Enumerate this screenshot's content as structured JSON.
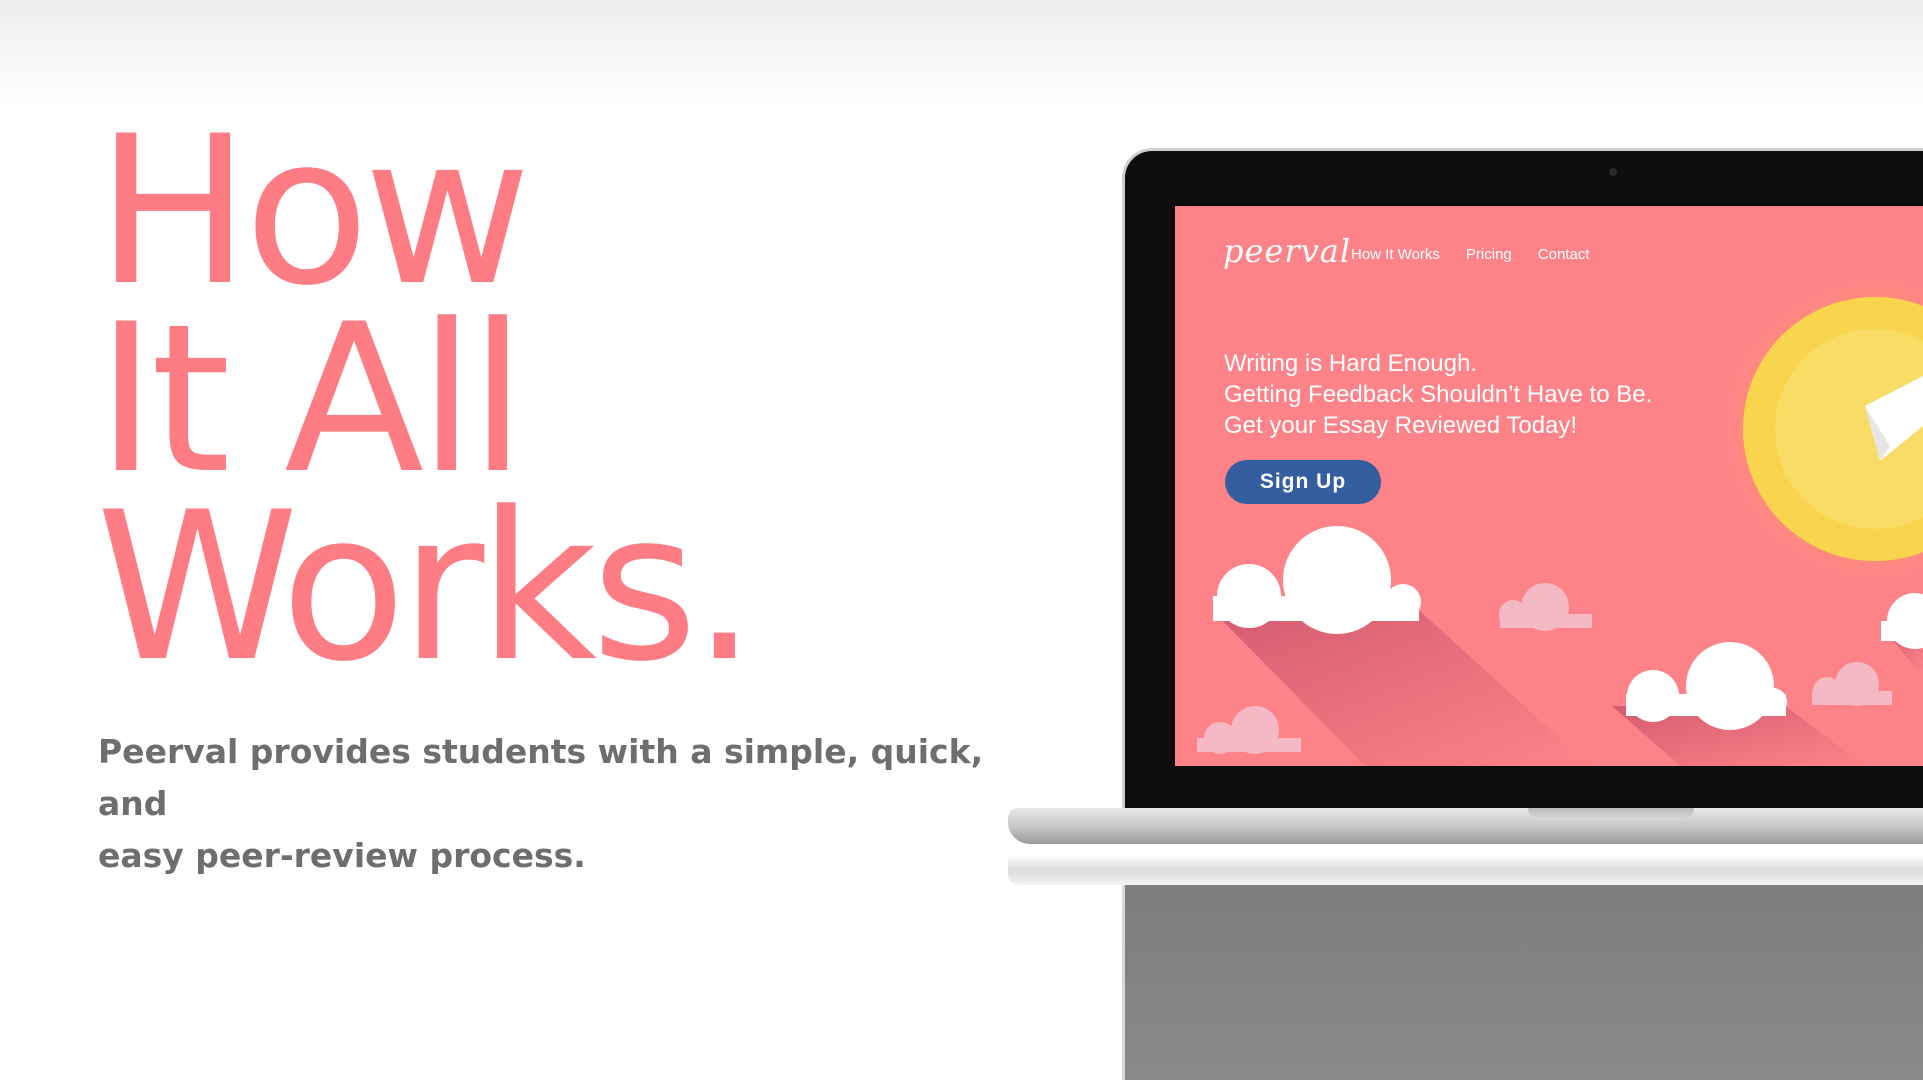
{
  "headline": {
    "line1": "How",
    "line2": "It All",
    "line3": "Works."
  },
  "tagline": {
    "line1": "Peerval provides students with a simple, quick, and",
    "line2": "easy peer-review process."
  },
  "site": {
    "logo": "peerval",
    "nav": [
      "How It Works",
      "Pricing",
      "Contact"
    ],
    "hero_lines": [
      "Writing is Hard Enough.",
      "Getting Feedback Shouldn’t Have to Be.",
      "Get your Essay Reviewed Today!"
    ],
    "signup_label": "Sign Up"
  },
  "colors": {
    "headline": "#fe7d84",
    "tagline": "#6e6e6e",
    "screen_bg": "#fe8389",
    "button": "#345ea0",
    "sun": "#f8d54c"
  }
}
